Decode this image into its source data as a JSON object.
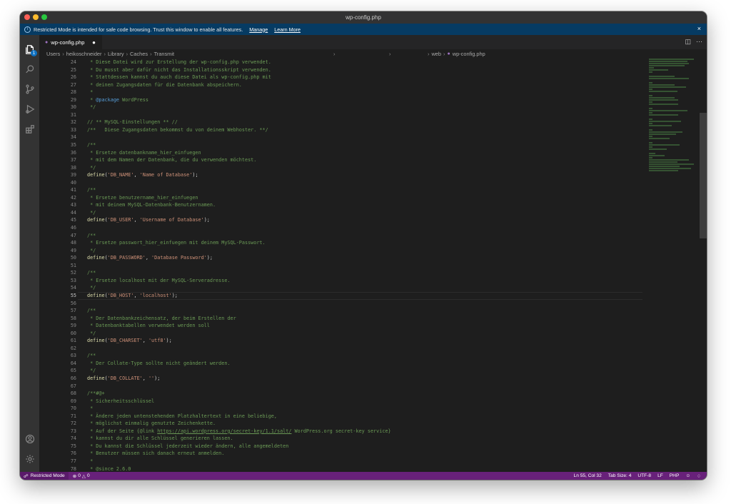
{
  "window": {
    "title": "wp-config.php"
  },
  "banner": {
    "message": "Restricted Mode is intended for safe code browsing. Trust this window to enable all features.",
    "manage": "Manage",
    "learn_more": "Learn More",
    "close": "×"
  },
  "activity_bar": {
    "explorer_badge": "1"
  },
  "tab": {
    "label": "wp-config.php",
    "dirty": "●",
    "icon_text": "php"
  },
  "breadcrumb": {
    "parts": [
      "Users",
      "heikoschneider",
      "Library",
      "Caches",
      "Transmit"
    ],
    "right_parts": [
      "web",
      "wp-config.php"
    ]
  },
  "editor": {
    "current_line": 55,
    "lines": [
      {
        "n": "24",
        "t": " * Diese Datei wird zur Erstellung der wp-config.php verwendet."
      },
      {
        "n": "25",
        "t": " * Du musst aber dafür nicht das Installationsskript verwenden."
      },
      {
        "n": "26",
        "t": " * Stattdessen kannst du auch diese Datei als wp-config.php mit"
      },
      {
        "n": "27",
        "t": " * deinen Zugangsdaten für die Datenbank abspeichern."
      },
      {
        "n": "28",
        "t": " *"
      },
      {
        "n": "29",
        "t": " * @package WordPress"
      },
      {
        "n": "30",
        "t": " */"
      },
      {
        "n": "31",
        "t": ""
      },
      {
        "n": "32",
        "t": "// ** MySQL-Einstellungen ** //"
      },
      {
        "n": "33",
        "t": "/**   Diese Zugangsdaten bekommst du von deinem Webhoster. **/"
      },
      {
        "n": "34",
        "t": ""
      },
      {
        "n": "35",
        "t": "/**"
      },
      {
        "n": "36",
        "t": " * Ersetze datenbankname_hier_einfuegen"
      },
      {
        "n": "37",
        "t": " * mit dem Namen der Datenbank, die du verwenden möchtest."
      },
      {
        "n": "38",
        "t": " */"
      },
      {
        "n": "39",
        "t": "define('DB_NAME', 'Name of Database');"
      },
      {
        "n": "40",
        "t": ""
      },
      {
        "n": "41",
        "t": "/**"
      },
      {
        "n": "42",
        "t": " * Ersetze benutzername_hier_einfuegen"
      },
      {
        "n": "43",
        "t": " * mit deinem MySQL-Datenbank-Benutzernamen."
      },
      {
        "n": "44",
        "t": " */"
      },
      {
        "n": "45",
        "t": "define('DB_USER', 'Username of Database');"
      },
      {
        "n": "46",
        "t": ""
      },
      {
        "n": "47",
        "t": "/**"
      },
      {
        "n": "48",
        "t": " * Ersetze passwort_hier_einfuegen mit deinem MySQL-Passwort."
      },
      {
        "n": "49",
        "t": " */"
      },
      {
        "n": "50",
        "t": "define('DB_PASSWORD', 'Database Password');"
      },
      {
        "n": "51",
        "t": ""
      },
      {
        "n": "52",
        "t": "/**"
      },
      {
        "n": "53",
        "t": " * Ersetze localhost mit der MySQL-Serveradresse."
      },
      {
        "n": "54",
        "t": " */"
      },
      {
        "n": "55",
        "t": "define('DB_HOST', 'localhost');"
      },
      {
        "n": "56",
        "t": ""
      },
      {
        "n": "57",
        "t": "/**"
      },
      {
        "n": "58",
        "t": " * Der Datenbankzeichensatz, der beim Erstellen der"
      },
      {
        "n": "59",
        "t": " * Datenbanktabellen verwendet werden soll"
      },
      {
        "n": "60",
        "t": " */"
      },
      {
        "n": "61",
        "t": "define('DB_CHARSET', 'utf8');"
      },
      {
        "n": "62",
        "t": ""
      },
      {
        "n": "63",
        "t": "/**"
      },
      {
        "n": "64",
        "t": " * Der Collate-Type sollte nicht geändert werden."
      },
      {
        "n": "65",
        "t": " */"
      },
      {
        "n": "66",
        "t": "define('DB_COLLATE', '');"
      },
      {
        "n": "67",
        "t": ""
      },
      {
        "n": "68",
        "t": "/**#@+"
      },
      {
        "n": "69",
        "t": " * Sicherheitsschlüssel"
      },
      {
        "n": "70",
        "t": " *"
      },
      {
        "n": "71",
        "t": " * Ändere jeden untenstehenden Platzhaltertext in eine beliebige,"
      },
      {
        "n": "72",
        "t": " * möglichst einmalig genutzte Zeichenkette."
      },
      {
        "n": "73",
        "t": " * Auf der Seite {@link https://api.wordpress.org/secret-key/1.1/salt/ WordPress.org secret-key service}"
      },
      {
        "n": "74",
        "t": " * kannst du dir alle Schlüssel generieren lassen."
      },
      {
        "n": "75",
        "t": " * Du kannst die Schlüssel jederzeit wieder ändern, alle angemeldeten"
      },
      {
        "n": "76",
        "t": " * Benutzer müssen sich danach erneut anmelden."
      },
      {
        "n": "77",
        "t": " *"
      },
      {
        "n": "78",
        "t": " * @since 2.6.0"
      }
    ]
  },
  "status": {
    "restricted": "Restricted Mode",
    "errors": "0",
    "warnings": "0",
    "position": "Ln 55, Col 32",
    "tab_size": "Tab Size: 4",
    "encoding": "UTF-8",
    "eol": "LF",
    "language": "PHP"
  },
  "colors": {
    "statusbar": "#68217a",
    "banner": "#063b63",
    "comment": "#6a9955",
    "keyword": "#569cd6",
    "function": "#dcdcaa",
    "string": "#ce9178"
  }
}
